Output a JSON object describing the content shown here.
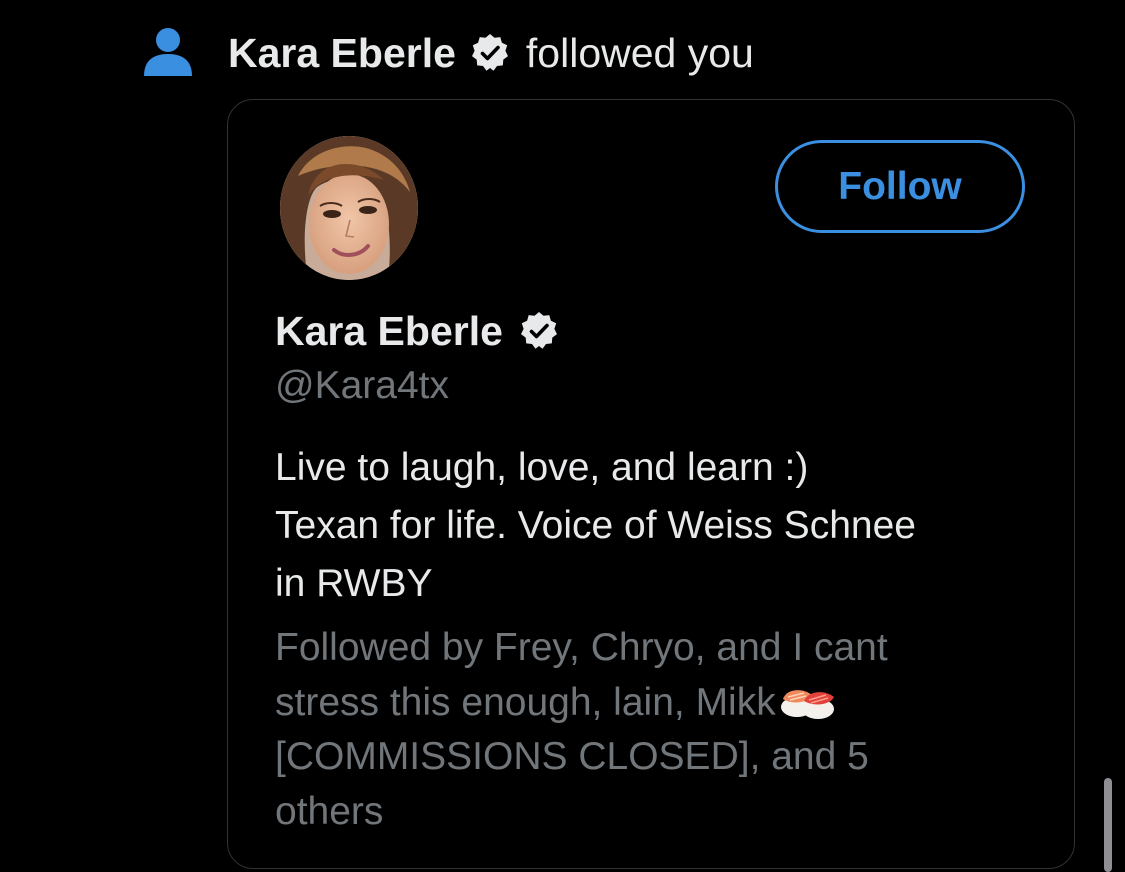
{
  "notification": {
    "name": "Kara Eberle",
    "action": "followed you",
    "icon": "person-icon",
    "icon_color": "#3b8fe0"
  },
  "profile_card": {
    "display_name": "Kara Eberle",
    "handle": "@Kara4tx",
    "verified": true,
    "follow_label": "Follow",
    "bio_lines": [
      "Live to laugh, love, and learn :)",
      "Texan for life. Voice of Weiss Schnee",
      "in RWBY"
    ],
    "followed_by_lines": [
      "Followed by Frey, Chryo, and I cant",
      "stress this enough, lain, Mikk",
      "[COMMISSIONS CLOSED], and 5",
      "others"
    ],
    "followed_by_emoji": "sushi-icon"
  },
  "colors": {
    "accent": "#3b8fe0",
    "background": "#000000",
    "text_primary": "#e7e9ea",
    "text_secondary": "#71767b",
    "card_border": "#2f3336"
  }
}
